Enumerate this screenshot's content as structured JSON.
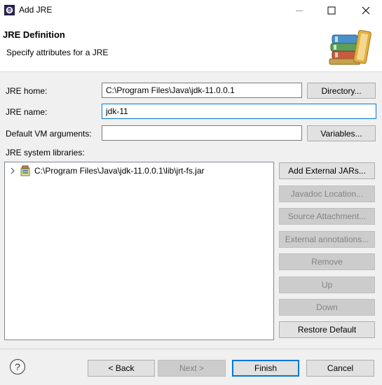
{
  "window": {
    "title": "Add JRE"
  },
  "banner": {
    "title": "JRE Definition",
    "subtitle": "Specify attributes for a JRE"
  },
  "form": {
    "jre_home_label": "JRE home:",
    "jre_home_value": "C:\\Program Files\\Java\\jdk-11.0.0.1",
    "jre_name_label": "JRE name:",
    "jre_name_value": "jdk-11",
    "vm_args_label": "Default VM arguments:",
    "vm_args_value": "",
    "libraries_label": "JRE system libraries:"
  },
  "buttons": {
    "directory": "Directory...",
    "variables": "Variables...",
    "add_external_jars": "Add External JARs...",
    "javadoc_location": "Javadoc Location...",
    "source_attachment": "Source Attachment...",
    "external_annotations": "External annotations...",
    "remove": "Remove",
    "up": "Up",
    "down": "Down",
    "restore_default": "Restore Default"
  },
  "libraries": [
    {
      "path": "C:\\Program Files\\Java\\jdk-11.0.0.1\\lib\\jrt-fs.jar",
      "icon": "jar-icon",
      "expanded": false
    }
  ],
  "footer": {
    "back": "< Back",
    "next": "Next >",
    "finish": "Finish",
    "cancel": "Cancel",
    "help_icon": "help-icon"
  },
  "colors": {
    "focus_border": "#0078d7",
    "disabled_text": "#838383",
    "dialog_bg": "#f0f0f0"
  }
}
